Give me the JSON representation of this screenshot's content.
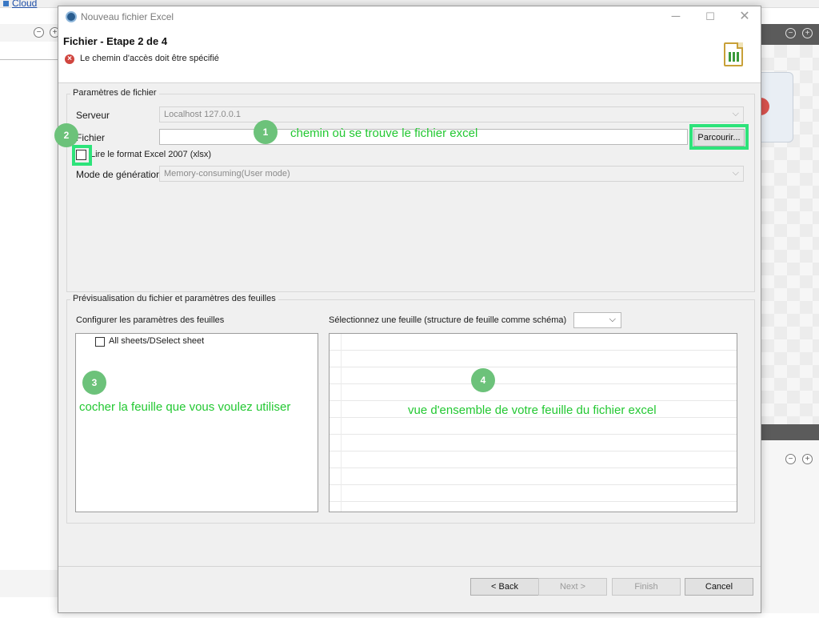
{
  "background": {
    "cloud_link": "Cloud"
  },
  "dialog": {
    "window_title": "Nouveau fichier Excel",
    "wizard_title": "Fichier - Etape 2 de 4",
    "error_message": "Le chemin d'accès doit être spécifié",
    "file_group": {
      "label": "Paramètres de fichier",
      "server_label": "Serveur",
      "server_value": "Localhost 127.0.0.1",
      "file_label": "Fichier",
      "file_value": "",
      "browse_button": "Parcourir...",
      "xlsx_checkbox_label": "Lire le format Excel 2007 (xlsx)",
      "mode_label": "Mode de génération",
      "mode_value": "Memory-consuming(User mode)"
    },
    "preview_group": {
      "label": "Prévisualisation du fichier et paramètres des feuilles",
      "sheets_config_label": "Configurer les paramètres des feuilles",
      "all_sheets_label": "All sheets/DSelect sheet",
      "select_sheet_label": "Sélectionnez une feuille (structure de feuille comme schéma)",
      "select_sheet_value": ""
    },
    "buttons": {
      "back": "< Back",
      "next": "Next >",
      "finish": "Finish",
      "cancel": "Cancel"
    }
  },
  "annotations": [
    {
      "number": "1",
      "text": "chemin où se trouve le fichier excel"
    },
    {
      "number": "2",
      "text": ""
    },
    {
      "number": "3",
      "text": "cocher la feuille que vous voulez utiliser"
    },
    {
      "number": "4",
      "text": "vue d'ensemble de votre feuille du fichier excel"
    }
  ],
  "colors": {
    "annotation_green": "#23c832",
    "highlight_green": "#2de37a",
    "badge_green": "#6cc27a",
    "error_red": "#d0453f"
  }
}
